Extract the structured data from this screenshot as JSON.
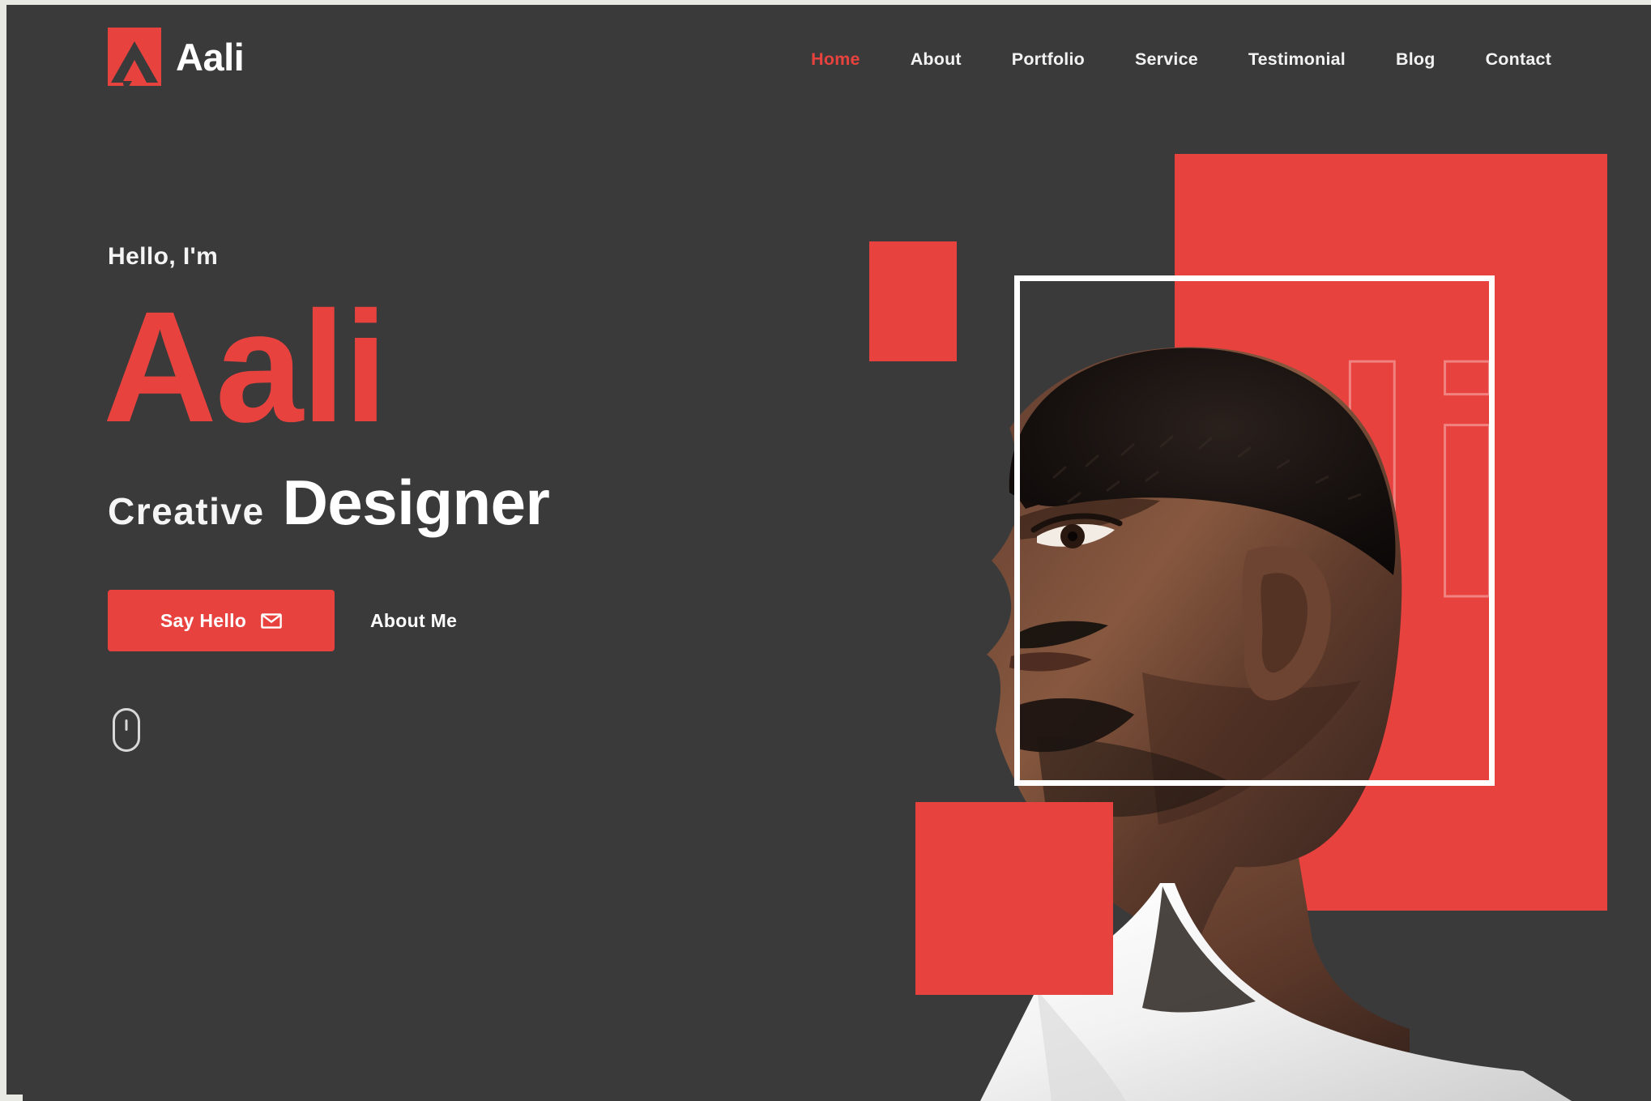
{
  "brand": {
    "name": "Aali",
    "logo_icon": "chevron-logo-mark",
    "logo_color": "#e8423f"
  },
  "nav": {
    "items": [
      {
        "label": "Home",
        "active": true
      },
      {
        "label": "About",
        "active": false
      },
      {
        "label": "Portfolio",
        "active": false
      },
      {
        "label": "Service",
        "active": false
      },
      {
        "label": "Testimonial",
        "active": false
      },
      {
        "label": "Blog",
        "active": false
      },
      {
        "label": "Contact",
        "active": false
      }
    ]
  },
  "hero": {
    "greeting": "Hello, I'm",
    "name": "Aali",
    "role_prefix": "Creative",
    "role_main": "Designer",
    "primary_button": {
      "label": "Say Hello",
      "icon": "envelope-icon"
    },
    "secondary_button": {
      "label": "About Me"
    },
    "scroll_indicator_icon": "mouse-scroll-icon"
  },
  "visual": {
    "ghost_text": "ali",
    "portrait_alt": "portrait-photo",
    "accent_color": "#e8423f",
    "background_color": "#3a3a3a",
    "frame_color": "#ffffff"
  }
}
